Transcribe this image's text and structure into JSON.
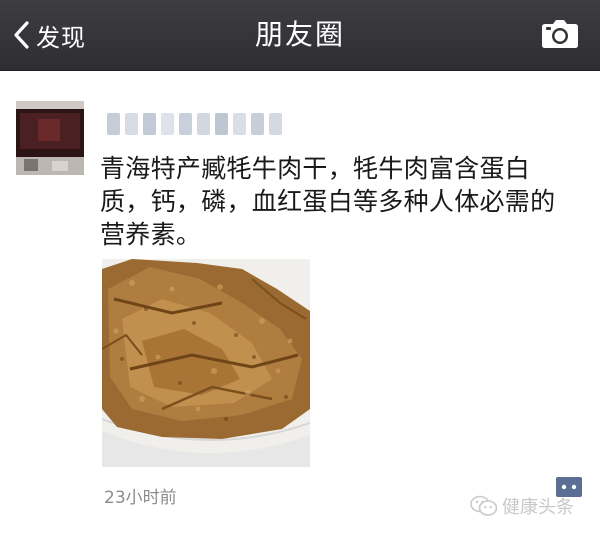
{
  "header": {
    "back_label": "发现",
    "title": "朋友圈",
    "camera_icon": "camera-icon"
  },
  "post": {
    "author_name": "",
    "text": "青海特产臧牦牛肉干，牦牛肉富含蛋白质，钙，磷，血红蛋白等多种人体必需的营养素。",
    "time": "23小时前",
    "comment_icon": "comment-bubble-icon"
  },
  "watermark": {
    "text": "健康头条",
    "icon": "wechat-logo-icon"
  },
  "colors": {
    "navbar": "#333337",
    "text": "#1a1a1a",
    "time": "#8c8c8c",
    "comment_button": "#5b6f95"
  }
}
